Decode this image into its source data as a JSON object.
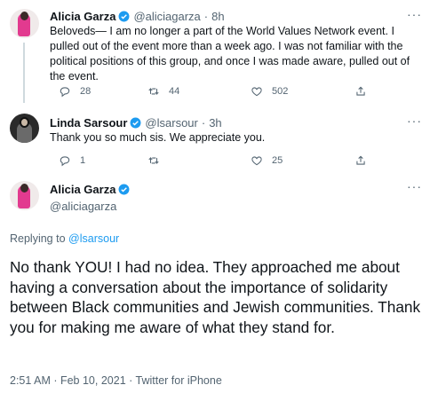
{
  "tweets": [
    {
      "name": "Alicia Garza",
      "handle": "@aliciagarza",
      "time": "8h",
      "text": "Beloveds— I am no longer a part of the World Values Network event. I pulled out of the event more than a week ago. I was not familiar with the political positions of this group, and once I was made aware, pulled out of the event.",
      "replies": "28",
      "retweets": "44",
      "likes": "502"
    },
    {
      "name": "Linda Sarsour",
      "handle": "@lsarsour",
      "time": "3h",
      "text": "Thank you so much sis. We appreciate you.",
      "replies": "1",
      "retweets": "",
      "likes": "25"
    }
  ],
  "main_tweet": {
    "name": "Alicia Garza",
    "handle": "@aliciagarza",
    "replying_prefix": "Replying to",
    "replying_to": "@lsarsour",
    "text": "No thank YOU! I had no idea. They approached me about having a conversation about the importance of solidarity between Black communities and Jewish communities. Thank you for making me aware of what they stand for.",
    "timestamp": "2:51 AM · Feb 10, 2021 · Twitter for iPhone"
  },
  "ui": {
    "separator": "·",
    "more_glyph": "···"
  },
  "colors": {
    "verified": "#1d9bf0",
    "link": "#1d9bf0",
    "secondary_text": "#536471"
  },
  "icons": [
    "verified-icon",
    "more-icon",
    "reply-icon",
    "retweet-icon",
    "like-icon",
    "share-icon"
  ]
}
